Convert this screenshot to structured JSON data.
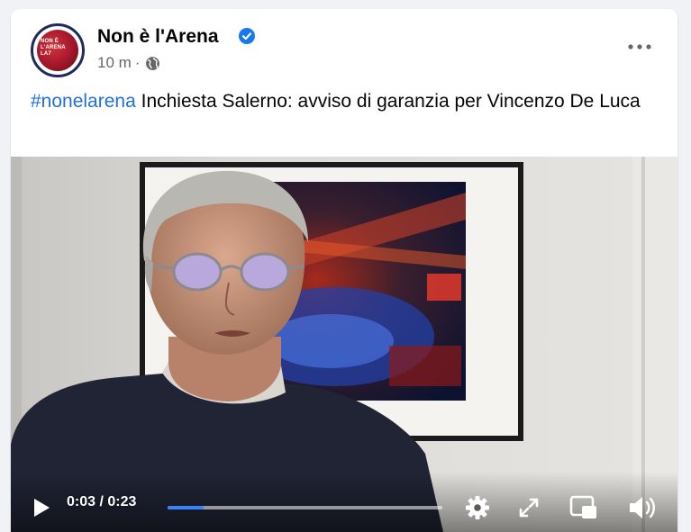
{
  "post": {
    "page_name": "Non è l'Arena",
    "timestamp": "10 m",
    "separator": "·",
    "hashtag": "#nonelarena",
    "text": " Inchiesta Salerno: avviso di garanzia per Vincenzo De Luca",
    "avatar_logo_lines": [
      "NON È",
      "L'ARENA",
      "LA7"
    ]
  },
  "video": {
    "current_time": "0:03",
    "time_separator": " / ",
    "duration": "0:23",
    "progress_fraction": 0.13
  },
  "icons": {
    "verified": "verified-badge-icon",
    "audience": "globe-icon",
    "more": "more-options-icon",
    "play": "play-icon",
    "settings": "gear-icon",
    "fullscreen": "expand-icon",
    "pip": "picture-in-picture-icon",
    "volume": "volume-icon"
  },
  "colors": {
    "hashtag": "#216fdb",
    "verified": "#1877f2",
    "progress": "#3b82f6"
  }
}
